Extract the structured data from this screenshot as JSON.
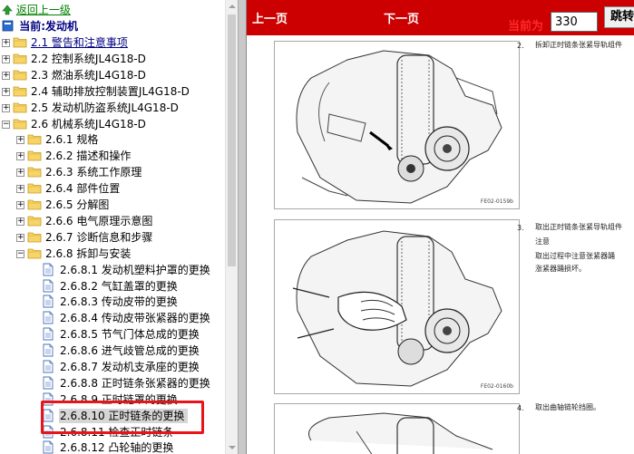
{
  "tree": {
    "go_up": "返回上一级",
    "current": "当前:发动机",
    "items": [
      {
        "level": 1,
        "label": "2.1 警告和注意事项",
        "type": "folder",
        "expand": "+",
        "highlight": true
      },
      {
        "level": 1,
        "label": "2.2 控制系统JL4G18-D",
        "type": "folder",
        "expand": "+"
      },
      {
        "level": 1,
        "label": "2.3 燃油系统JL4G18-D",
        "type": "folder",
        "expand": "+"
      },
      {
        "level": 1,
        "label": "2.4 辅助排放控制装置JL4G18-D",
        "type": "folder",
        "expand": "+"
      },
      {
        "level": 1,
        "label": "2.5 发动机防盗系统JL4G18-D",
        "type": "folder",
        "expand": "+"
      },
      {
        "level": 1,
        "label": "2.6 机械系统JL4G18-D",
        "type": "folder",
        "expand": "-"
      },
      {
        "level": 2,
        "label": "2.6.1 规格",
        "type": "folder",
        "expand": "+"
      },
      {
        "level": 2,
        "label": "2.6.2 描述和操作",
        "type": "folder",
        "expand": "+"
      },
      {
        "level": 2,
        "label": "2.6.3 系统工作原理",
        "type": "folder",
        "expand": "+"
      },
      {
        "level": 2,
        "label": "2.6.4 部件位置",
        "type": "folder",
        "expand": "+"
      },
      {
        "level": 2,
        "label": "2.6.5 分解图",
        "type": "folder",
        "expand": "+"
      },
      {
        "level": 2,
        "label": "2.6.6 电气原理示意图",
        "type": "folder",
        "expand": "+"
      },
      {
        "level": 2,
        "label": "2.6.7 诊断信息和步骤",
        "type": "folder",
        "expand": "+"
      },
      {
        "level": 2,
        "label": "2.6.8 拆卸与安装",
        "type": "folder",
        "expand": "-"
      },
      {
        "level": 3,
        "label": "2.6.8.1 发动机塑料护罩的更换",
        "type": "doc"
      },
      {
        "level": 3,
        "label": "2.6.8.2 气缸盖罩的更换",
        "type": "doc"
      },
      {
        "level": 3,
        "label": "2.6.8.3 传动皮带的更换",
        "type": "doc"
      },
      {
        "level": 3,
        "label": "2.6.8.4 传动皮带张紧器的更换",
        "type": "doc"
      },
      {
        "level": 3,
        "label": "2.6.8.5 节气门体总成的更换",
        "type": "doc"
      },
      {
        "level": 3,
        "label": "2.6.8.6 进气歧管总成的更换",
        "type": "doc"
      },
      {
        "level": 3,
        "label": "2.6.8.7 发动机支承座的更换",
        "type": "doc"
      },
      {
        "level": 3,
        "label": "2.6.8.8 正时链条张紧器的更换",
        "type": "doc"
      },
      {
        "level": 3,
        "label": "2.6.8.9 正时链罩的更换",
        "type": "doc"
      },
      {
        "level": 3,
        "label": "2.6.8.10 正时链条的更换",
        "type": "doc",
        "selected": true
      },
      {
        "level": 3,
        "label": "2.6.8.11 检查正时链条",
        "type": "doc"
      },
      {
        "level": 3,
        "label": "2.6.8.12 凸轮轴的更换",
        "type": "doc"
      }
    ]
  },
  "toolbar": {
    "prev": "上一页",
    "next": "下一页",
    "current_label": "当前为",
    "page_value": "330",
    "jump": "跳转"
  },
  "document": {
    "steps": [
      {
        "num": "2.",
        "lines": [
          "拆卸正时链条张紧导轨组件"
        ]
      },
      {
        "num": "3.",
        "lines": [
          "取出正时链条张紧导轨组件",
          "注意",
          "取出过程中注意张紧器踊",
          "涨紧器踊损坏。"
        ]
      },
      {
        "num": "4.",
        "lines": [
          "取出曲轴链轮挡圈。"
        ]
      }
    ],
    "figure_captions": [
      "FE02-0159b",
      "FE02-0160b"
    ]
  },
  "colors": {
    "toolbar_bg": "#cc0000",
    "link_green": "#008000",
    "selection_box": "#e8141a"
  }
}
